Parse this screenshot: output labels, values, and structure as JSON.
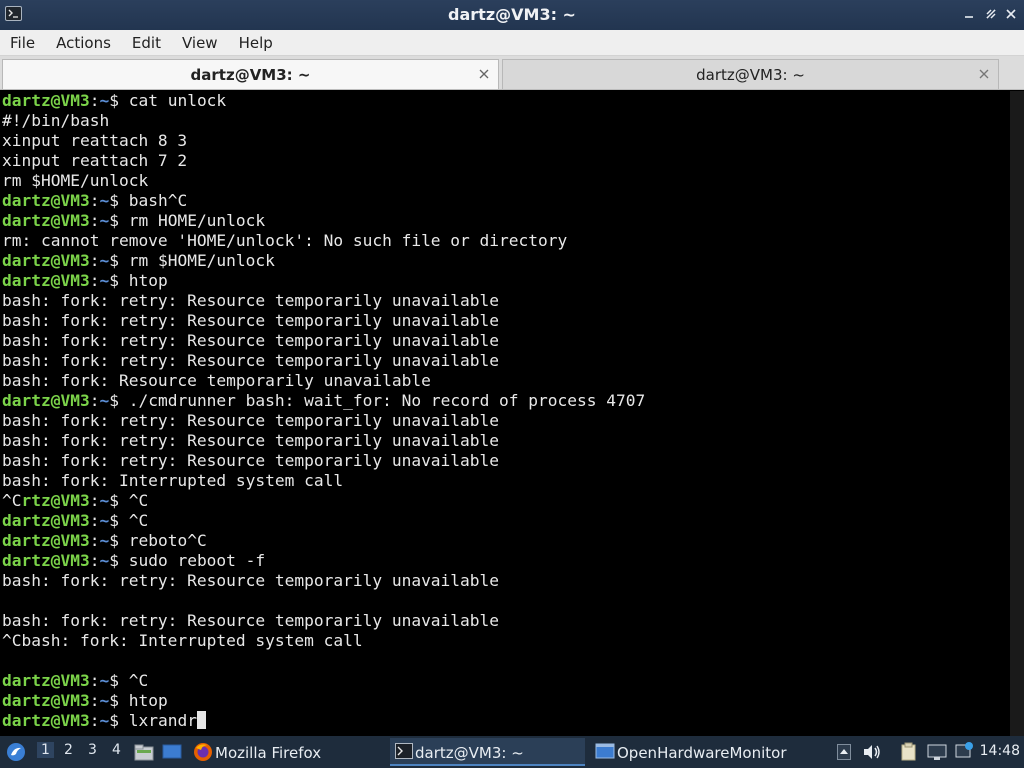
{
  "window": {
    "title": "dartz@VM3: ~",
    "buttons": [
      "minimize",
      "maximize",
      "close"
    ]
  },
  "menu": [
    "File",
    "Actions",
    "Edit",
    "View",
    "Help"
  ],
  "tabs": [
    {
      "label": "dartz@VM3: ~",
      "active": true
    },
    {
      "label": "dartz@VM3: ~",
      "active": false
    }
  ],
  "prompt": {
    "user_host": "dartz@VM3",
    "sep": ":",
    "path": "~",
    "symbol": "$ "
  },
  "terminal_lines": [
    {
      "kind": "cmd",
      "text": "cat unlock"
    },
    {
      "kind": "out",
      "text": "#!/bin/bash"
    },
    {
      "kind": "out",
      "text": "xinput reattach 8 3"
    },
    {
      "kind": "out",
      "text": "xinput reattach 7 2"
    },
    {
      "kind": "out",
      "text": "rm $HOME/unlock"
    },
    {
      "kind": "cmd",
      "text": "bash^C"
    },
    {
      "kind": "cmd",
      "text": "rm HOME/unlock"
    },
    {
      "kind": "out",
      "text": "rm: cannot remove 'HOME/unlock': No such file or directory"
    },
    {
      "kind": "cmd",
      "text": "rm $HOME/unlock"
    },
    {
      "kind": "cmd",
      "text": "htop"
    },
    {
      "kind": "out",
      "text": "bash: fork: retry: Resource temporarily unavailable"
    },
    {
      "kind": "out",
      "text": "bash: fork: retry: Resource temporarily unavailable"
    },
    {
      "kind": "out",
      "text": "bash: fork: retry: Resource temporarily unavailable"
    },
    {
      "kind": "out",
      "text": "bash: fork: retry: Resource temporarily unavailable"
    },
    {
      "kind": "out",
      "text": "bash: fork: Resource temporarily unavailable"
    },
    {
      "kind": "cmd",
      "text": "./cmdrunner bash: wait_for: No record of process 4707"
    },
    {
      "kind": "out",
      "text": "bash: fork: retry: Resource temporarily unavailable"
    },
    {
      "kind": "out",
      "text": "bash: fork: retry: Resource temporarily unavailable"
    },
    {
      "kind": "out",
      "text": "bash: fork: retry: Resource temporarily unavailable"
    },
    {
      "kind": "out",
      "text": "bash: fork: Interrupted system call"
    },
    {
      "kind": "cmd",
      "prefix": "^C",
      "text": "^C",
      "prompt_tail": "rtz@VM3"
    },
    {
      "kind": "cmd",
      "text": "^C"
    },
    {
      "kind": "cmd",
      "text": "reboto^C"
    },
    {
      "kind": "cmd",
      "text": "sudo reboot -f"
    },
    {
      "kind": "out",
      "text": "bash: fork: retry: Resource temporarily unavailable"
    },
    {
      "kind": "out",
      "text": ""
    },
    {
      "kind": "out",
      "text": "bash: fork: retry: Resource temporarily unavailable"
    },
    {
      "kind": "out",
      "text": "^Cbash: fork: Interrupted system call"
    },
    {
      "kind": "out",
      "text": ""
    },
    {
      "kind": "cmd",
      "text": "^C"
    },
    {
      "kind": "cmd",
      "text": "htop"
    },
    {
      "kind": "cmd",
      "text": "lxrandr",
      "cursor": true
    }
  ],
  "taskbar": {
    "desktops": [
      "1",
      "2",
      "3",
      "4"
    ],
    "active_desktop": "1",
    "tasks": [
      {
        "label": "Mozilla Firefox",
        "icon": "firefox-icon"
      },
      {
        "label": "dartz@VM3: ~",
        "icon": "terminal-icon",
        "active": true
      },
      {
        "label": "OpenHardwareMonitor",
        "icon": "window-icon"
      }
    ],
    "clock": "14:48"
  }
}
